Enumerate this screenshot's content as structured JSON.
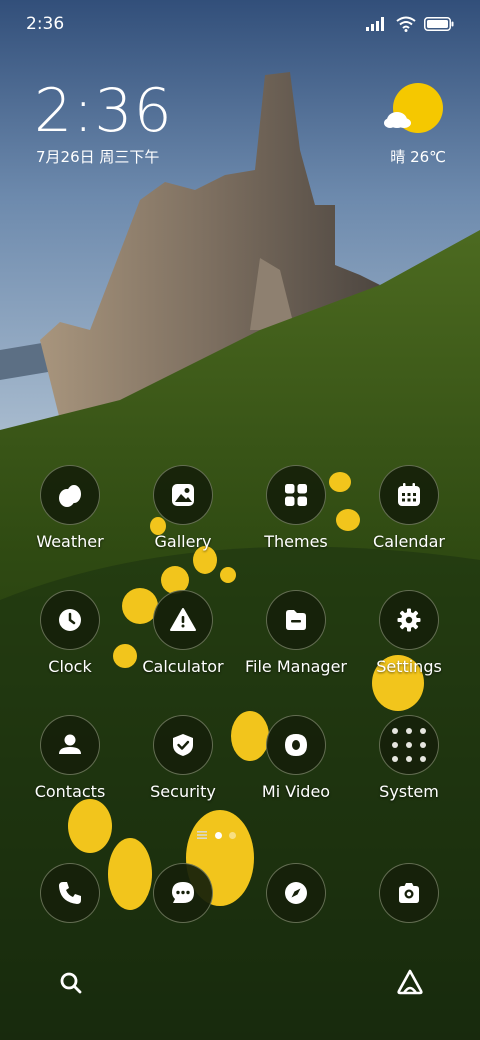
{
  "status_bar": {
    "time": "2:36"
  },
  "lock_widget": {
    "time": "2:36",
    "date": "7月26日 周三下午",
    "weather_text": "晴 26℃"
  },
  "apps": [
    {
      "label": "Weather"
    },
    {
      "label": "Gallery"
    },
    {
      "label": "Themes"
    },
    {
      "label": "Calendar"
    },
    {
      "label": "Clock"
    },
    {
      "label": "Calculator"
    },
    {
      "label": "File Manager"
    },
    {
      "label": "Settings"
    },
    {
      "label": "Contacts"
    },
    {
      "label": "Security"
    },
    {
      "label": "Mi Video"
    },
    {
      "label": "System"
    }
  ],
  "dock": [
    "phone-icon",
    "messages-icon",
    "browser-icon",
    "camera-icon"
  ],
  "page_indicator": {
    "pages": 3,
    "current": 2
  },
  "colors": {
    "icon_bg": "#16200a",
    "sun": "#f5c800"
  }
}
